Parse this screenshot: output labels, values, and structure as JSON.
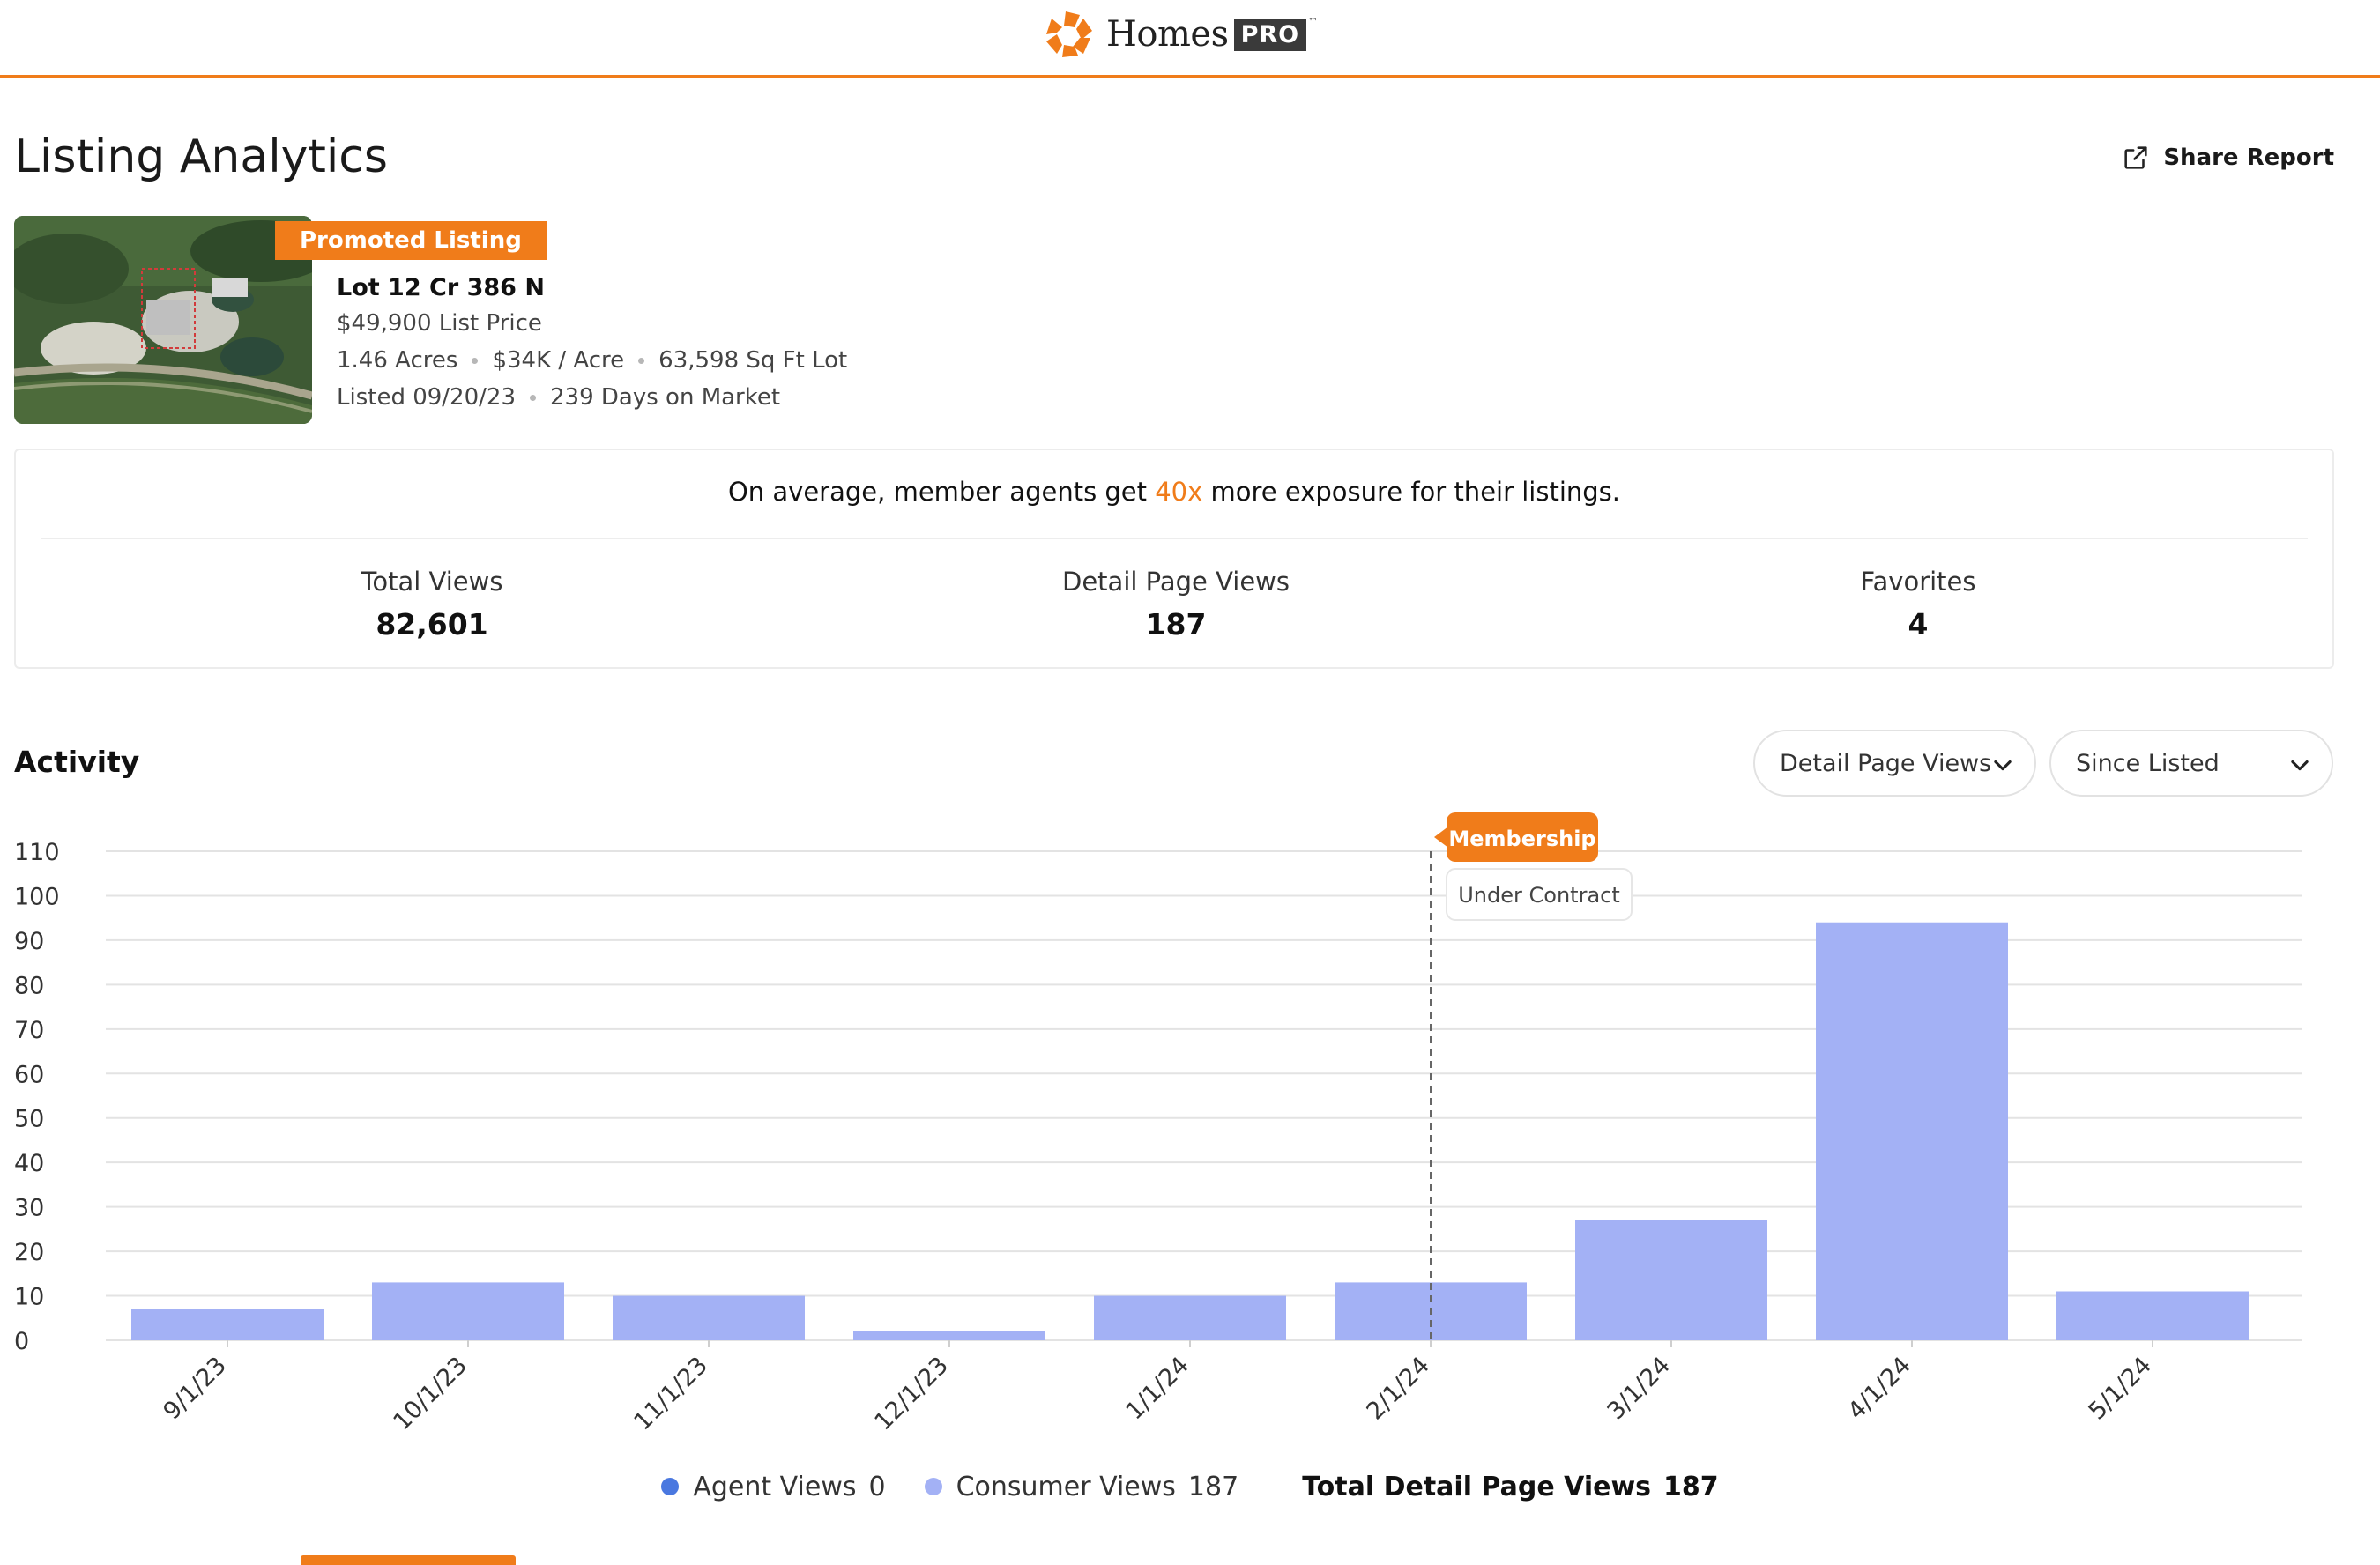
{
  "brand": {
    "name": "Homes",
    "pro": "PRO",
    "tm": "™"
  },
  "page": {
    "title": "Listing Analytics",
    "share_label": "Share Report"
  },
  "listing": {
    "badge": "Promoted Listing",
    "address": "Lot 12 Cr 386 N",
    "price": "$49,900 List Price",
    "facts": [
      "1.46 Acres",
      "$34K / Acre",
      "63,598 Sq Ft Lot"
    ],
    "listed": [
      "Listed 09/20/23",
      "239 Days on Market"
    ]
  },
  "stats": {
    "message_before": "On average, member agents get ",
    "message_highlight": "40x",
    "message_after": " more exposure for their listings.",
    "items": [
      {
        "label": "Total Views",
        "value": "82,601"
      },
      {
        "label": "Detail Page Views",
        "value": "187"
      },
      {
        "label": "Favorites",
        "value": "4"
      }
    ]
  },
  "activity": {
    "title": "Activity",
    "metric_select": "Detail Page Views",
    "range_select": "Since Listed"
  },
  "chart_data": {
    "type": "bar",
    "categories": [
      "9/1/23",
      "10/1/23",
      "11/1/23",
      "12/1/23",
      "1/1/24",
      "2/1/24",
      "3/1/24",
      "4/1/24",
      "5/1/24"
    ],
    "series": [
      {
        "name": "Agent Views",
        "values": [
          0,
          0,
          0,
          0,
          0,
          0,
          0,
          0,
          0
        ]
      },
      {
        "name": "Consumer Views",
        "values": [
          7,
          13,
          10,
          2,
          10,
          13,
          27,
          94,
          11
        ]
      }
    ],
    "yticks": [
      0,
      10,
      20,
      30,
      40,
      50,
      60,
      70,
      80,
      90,
      100,
      110
    ],
    "ylim": [
      0,
      110
    ],
    "grid": true,
    "marker": {
      "category": "2/1/24",
      "label": "Membership",
      "note": "Under Contract"
    }
  },
  "legend": {
    "agent_label": "Agent Views",
    "agent_value": "0",
    "consumer_label": "Consumer Views",
    "consumer_value": "187",
    "total_label": "Total Detail Page Views",
    "total_value": "187"
  },
  "colors": {
    "accent": "#f07c1a",
    "consumer_bar": "#a3b1f5",
    "agent_dot": "#4a78e0",
    "consumer_dot": "#a3b1f5",
    "grid": "#e3e3e3"
  }
}
